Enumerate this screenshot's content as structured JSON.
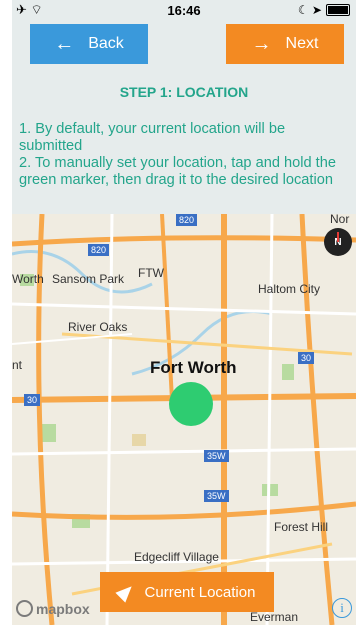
{
  "status_bar": {
    "time": "16:46",
    "left_icons": "✈ ⌔",
    "right_icons": "☾ ➤"
  },
  "nav": {
    "back_label": "Back",
    "next_label": "Next"
  },
  "step_title": "STEP 1: LOCATION",
  "instructions": [
    "1. By default, your current location will be submitted",
    "2. To manually set your location, tap and hold the green marker, then drag it to the desired location"
  ],
  "map": {
    "labels": {
      "worth": "Worth",
      "sansom_park": "Sansom Park",
      "ftw": "FTW",
      "haltom_city": "Haltom City",
      "river_oaks": "River Oaks",
      "fort_worth": "Fort Worth",
      "forest_hill": "Forest Hill",
      "edgecliff_village": "Edgecliff Village",
      "everman": "Everman",
      "nt": "nt",
      "nor": "Nor"
    },
    "shields": {
      "i820_a": "820",
      "i820_b": "820",
      "i30_a": "30",
      "i30_b": "30",
      "i35w_a": "35W",
      "i35w_b": "35W"
    },
    "compass_label": "N",
    "marker_color": "#2ecc71"
  },
  "current_location_label": "Current Location",
  "attribution": {
    "logo_text": "mapbox",
    "info_glyph": "i"
  },
  "colors": {
    "accent_blue": "#3a99db",
    "accent_orange": "#f38a22",
    "text_green": "#23a58b",
    "header_bg": "#e6ecec"
  }
}
